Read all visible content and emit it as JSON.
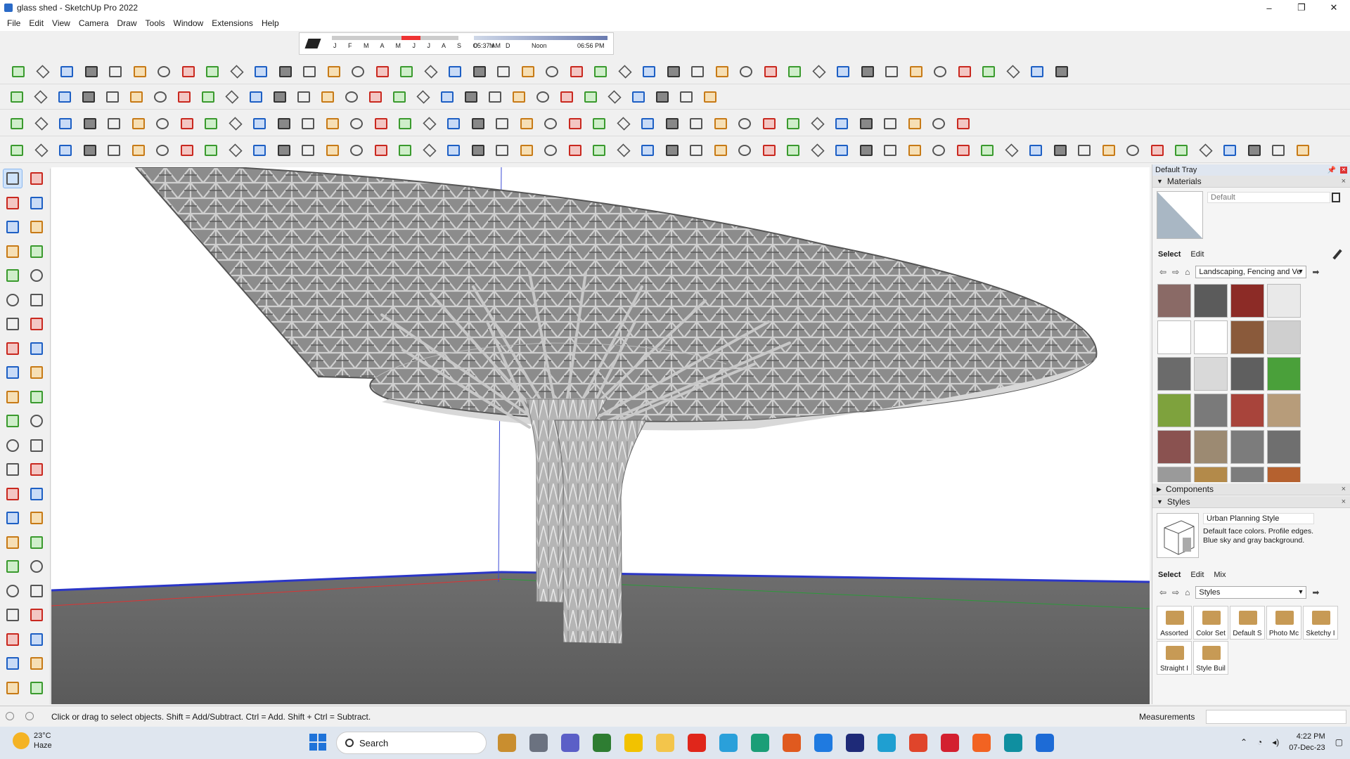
{
  "window": {
    "title": "glass shed - SketchUp Pro 2022",
    "controls": [
      "–",
      "❐",
      "✕"
    ]
  },
  "menu": [
    "File",
    "Edit",
    "View",
    "Camera",
    "Draw",
    "Tools",
    "Window",
    "Extensions",
    "Help"
  ],
  "shadows": {
    "months": "J F M A M J J A S O N D",
    "sunrise": "05:37 AM",
    "noon": "Noon",
    "sunset": "06:56 PM"
  },
  "status": {
    "message": "Click or drag to select objects. Shift = Add/Subtract. Ctrl = Add. Shift + Ctrl = Subtract.",
    "measurements_label": "Measurements"
  },
  "tray": {
    "title": "Default Tray",
    "materials": {
      "header": "Materials",
      "current": "Default",
      "tabs": [
        "Select",
        "Edit"
      ],
      "collection": "Landscaping, Fencing and Ve",
      "swatch_colors": [
        "#8a6a66",
        "#5b5b5b",
        "#8c2b26",
        "#e9e9e9",
        "#ffffff",
        "#ffffff",
        "#8a5a3b",
        "#cfcfcf",
        "#6b6b6b",
        "#d9d9d9",
        "#5f5f5f",
        "#4aa03a",
        "#7ea23d",
        "#7a7a7a",
        "#a8443b",
        "#b79c7a",
        "#8a5250",
        "#9c8a72",
        "#7c7c7c",
        "#6f6f6f",
        "#9a9a9a",
        "#b38a4a",
        "#7d7d7d",
        "#b5612f"
      ]
    },
    "components": {
      "header": "Components"
    },
    "styles": {
      "header": "Styles",
      "name": "Urban Planning Style",
      "description": "Default face colors.  Profile edges. Blue sky and gray background.",
      "tabs": [
        "Select",
        "Edit",
        "Mix"
      ],
      "collection": "Styles",
      "folders": [
        "Assorted",
        "Color Set",
        "Default S",
        "Photo Mc",
        "Sketchy I",
        "Straight I",
        "Style Buil"
      ]
    }
  },
  "taskbar": {
    "weather_temp": "23°C",
    "weather_cond": "Haze",
    "search_placeholder": "Search",
    "time": "4:22 PM",
    "date": "07-Dec-23",
    "apps": [
      "file-manager",
      "vm-app",
      "teams",
      "calculator",
      "sticky-notes",
      "explorer",
      "opera",
      "telegram",
      "pycharm",
      "git-client",
      "vscode",
      "photoshop",
      "autodesk",
      "chrome",
      "pinterest",
      "soundcloud",
      "sketchup-3d-warehouse",
      "sketchup"
    ]
  }
}
